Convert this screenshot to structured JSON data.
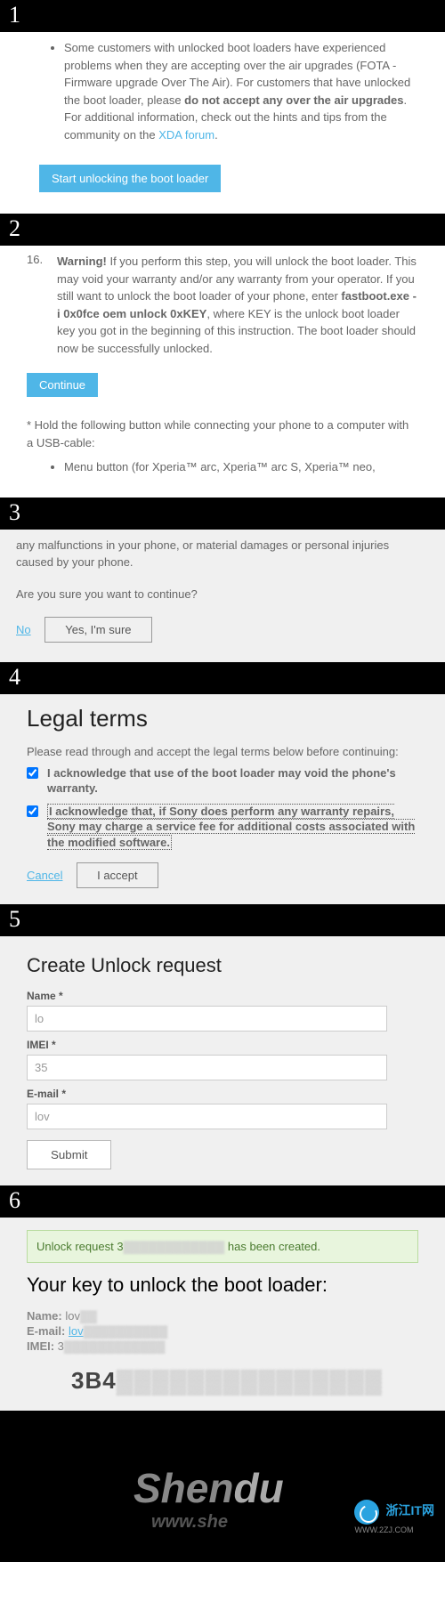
{
  "steps": {
    "n1": "1",
    "n2": "2",
    "n3": "3",
    "n4": "4",
    "n5": "5",
    "n6": "6"
  },
  "s1": {
    "bullet_a": "Some customers with unlocked boot loaders have experienced problems when they are accepting over the air upgrades (FOTA - Firmware upgrade Over The Air). For customers that have unlocked the boot loader, please ",
    "bullet_b": "do not accept any over the air upgrades",
    "bullet_c": ". For additional information, check out the hints and tips from the community on the ",
    "link": "XDA forum",
    "bullet_d": ".",
    "btn": "Start unlocking the boot loader"
  },
  "s2": {
    "num": "16.",
    "w": "Warning!",
    "a": " If you perform this step, you will unlock the boot loader. This may void your warranty and/or any warranty from your operator. If you still want to unlock the boot loader of your phone, enter ",
    "cmd": "fastboot.exe -i 0x0fce oem unlock 0xKEY",
    "b": ", where KEY is the unlock boot loader key you got in the beginning of this instruction. The boot loader should now be successfully unlocked.",
    "btn": "Continue",
    "note": "* Hold the following button while connecting your phone to a computer with a USB-cable:",
    "li": "Menu button (for Xperia™ arc, Xperia™ arc S, Xperia™ neo,"
  },
  "s3": {
    "a": "any malfunctions in your phone, or material damages or personal injuries caused by your phone.",
    "b": "Are you sure you want to continue?",
    "no": "No",
    "yes": "Yes, I'm sure"
  },
  "s4": {
    "title": "Legal terms",
    "intro": "Please read through and accept the legal terms below before continuing:",
    "c1": "I acknowledge that use of the boot loader may void the phone's warranty.",
    "c2": "I acknowledge that, if Sony does perform any warranty repairs, Sony may charge a service fee for additional costs associated with the modified software.",
    "cancel": "Cancel",
    "accept": "I accept"
  },
  "s5": {
    "title": "Create Unlock request",
    "name_l": "Name *",
    "name_v": "lo",
    "imei_l": "IMEI *",
    "imei_v": "35",
    "email_l": "E-mail *",
    "email_v": "lov",
    "submit": "Submit"
  },
  "s6": {
    "succ_a": "Unlock request 3",
    "succ_b": " has been created.",
    "title": "Your key to unlock the boot loader:",
    "name_l": "Name: ",
    "name_v": "lov",
    "email_l": "E-mail: ",
    "email_v": "lov",
    "imei_l": "IMEI: ",
    "imei_v": "3",
    "key": "3B4"
  },
  "footer": {
    "brand_a": "Shen",
    "brand_b": "du",
    "wm": "www.she",
    "badge_t": "浙江IT网",
    "badge_s": "WWW.2ZJ.COM"
  }
}
